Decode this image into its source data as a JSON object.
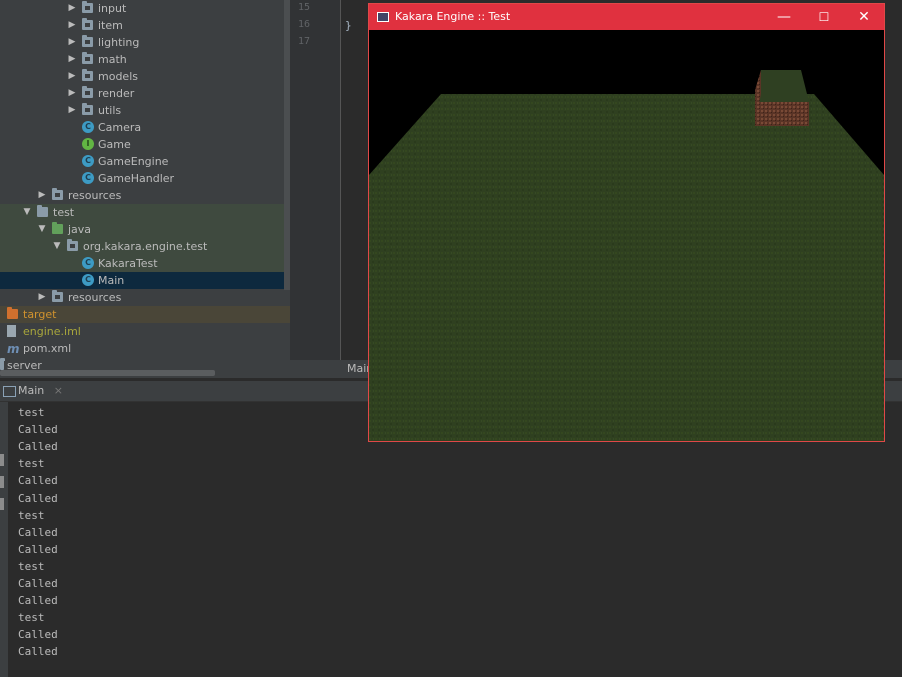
{
  "project_tree": {
    "items": [
      {
        "label": "input",
        "type": "folder",
        "depth": 4,
        "expanded": false
      },
      {
        "label": "item",
        "type": "folder",
        "depth": 4,
        "expanded": false
      },
      {
        "label": "lighting",
        "type": "folder",
        "depth": 4,
        "expanded": false
      },
      {
        "label": "math",
        "type": "folder",
        "depth": 4,
        "expanded": false
      },
      {
        "label": "models",
        "type": "folder",
        "depth": 4,
        "expanded": false
      },
      {
        "label": "render",
        "type": "folder",
        "depth": 4,
        "expanded": false
      },
      {
        "label": "utils",
        "type": "folder",
        "depth": 4,
        "expanded": false
      },
      {
        "label": "Camera",
        "type": "class",
        "depth": 5
      },
      {
        "label": "Game",
        "type": "interface",
        "depth": 5
      },
      {
        "label": "GameEngine",
        "type": "class",
        "depth": 5
      },
      {
        "label": "GameHandler",
        "type": "class",
        "depth": 5
      },
      {
        "label": "resources",
        "type": "resources",
        "depth": 2,
        "expanded": false
      },
      {
        "label": "test",
        "type": "folder",
        "depth": 1,
        "expanded": true
      },
      {
        "label": "java",
        "type": "folder-green",
        "depth": 2,
        "expanded": true
      },
      {
        "label": "org.kakara.engine.test",
        "type": "package",
        "depth": 3,
        "expanded": true
      },
      {
        "label": "KakaraTest",
        "type": "class",
        "depth": 5
      },
      {
        "label": "Main",
        "type": "class-main",
        "depth": 5
      },
      {
        "label": "resources",
        "type": "resources",
        "depth": 2,
        "expanded": false
      },
      {
        "label": "target",
        "type": "folder-orange",
        "depth": 0
      },
      {
        "label": "engine.iml",
        "type": "file",
        "depth": 0
      },
      {
        "label": "pom.xml",
        "type": "maven",
        "depth": 0
      },
      {
        "label": "server",
        "type": "module",
        "depth": 0
      }
    ]
  },
  "editor": {
    "line_numbers": [
      "15",
      "16",
      "17"
    ],
    "lines": [
      "",
      "}",
      ""
    ],
    "tab_label": "Main"
  },
  "run_panel": {
    "tab_label": "Main",
    "close_glyph": "×",
    "output": [
      "test",
      "Called",
      "Called",
      "test",
      "Called",
      "Called",
      "test",
      "Called",
      "Called",
      "test",
      "Called",
      "Called",
      "test",
      "Called",
      "Called"
    ]
  },
  "game_window": {
    "title": "Kakara Engine :: Test",
    "minimize_glyph": "—",
    "maximize_glyph": "☐",
    "close_glyph": "✕"
  },
  "colors": {
    "title_bar": "#e0313f",
    "grass": "#2f4020",
    "dirt": "#6b3c2c"
  }
}
